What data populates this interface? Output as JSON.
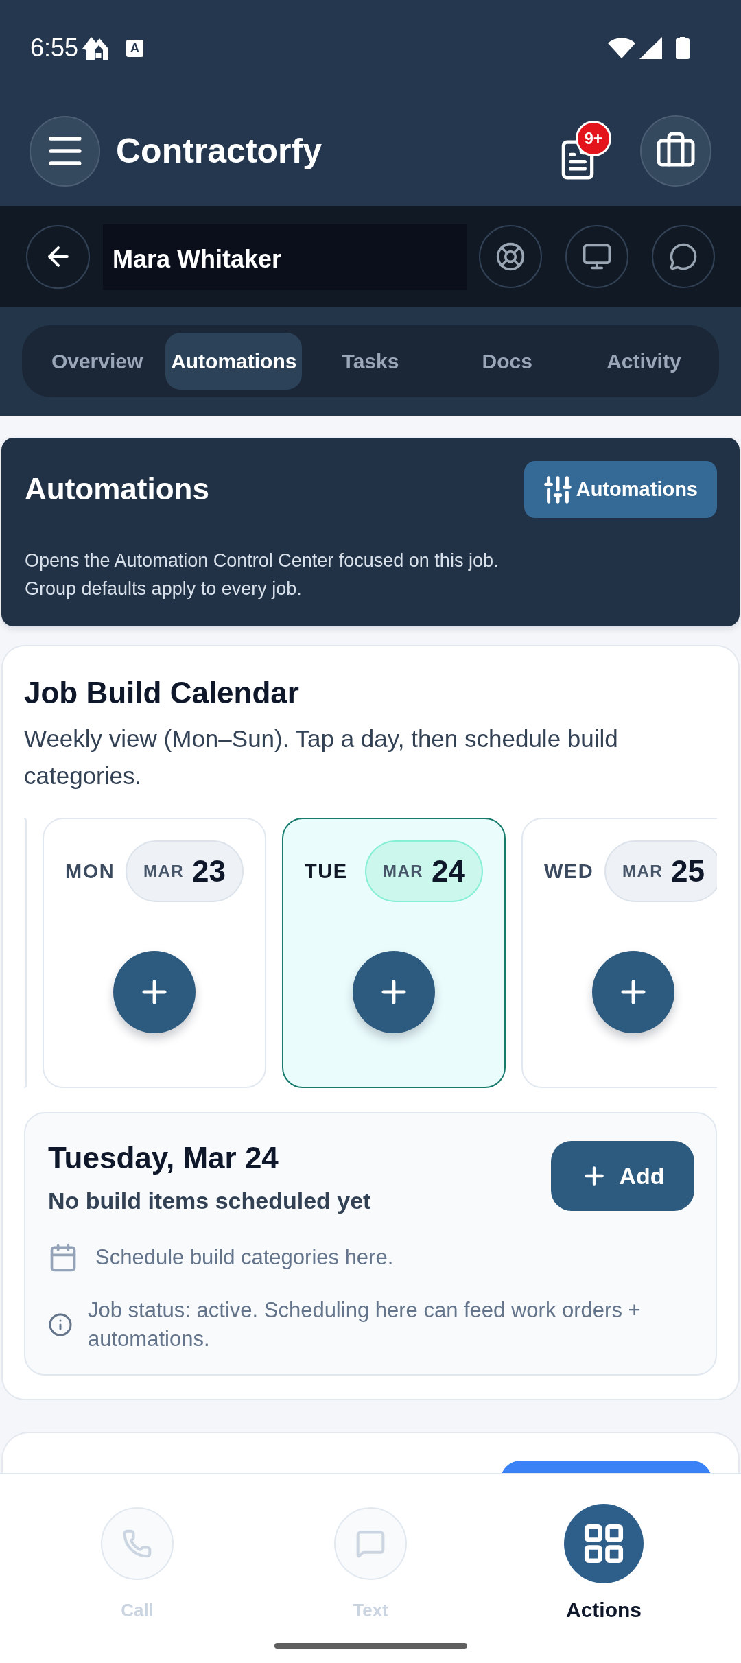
{
  "status_bar": {
    "time": "6:55",
    "notification_letter": "A"
  },
  "header": {
    "title": "Contractorfy",
    "badge": "9+"
  },
  "job_bar": {
    "name": "Mara Whitaker"
  },
  "tabs": [
    {
      "label": "Overview",
      "selected": false
    },
    {
      "label": "Automations",
      "selected": true
    },
    {
      "label": "Tasks",
      "selected": false
    },
    {
      "label": "Docs",
      "selected": false
    },
    {
      "label": "Activity",
      "selected": false
    }
  ],
  "automations_card": {
    "title": "Automations",
    "button": "Automations",
    "lines": [
      "Opens the Automation Control Center focused on this job.",
      "Group defaults apply to every job."
    ]
  },
  "calendar": {
    "title": "Job Build Calendar",
    "description": "Weekly view (Mon–Sun). Tap a day, then schedule build categories.",
    "days": [
      {
        "weekday": "MON",
        "month": "MAR",
        "day": "23",
        "selected": false
      },
      {
        "weekday": "TUE",
        "month": "MAR",
        "day": "24",
        "selected": true
      },
      {
        "weekday": "WED",
        "month": "MAR",
        "day": "25",
        "selected": false
      }
    ],
    "detail": {
      "title": "Tuesday, Mar 24",
      "subtitle": "No build items scheduled yet",
      "button": "Add",
      "notes": [
        {
          "kind": "calendar",
          "text": "Schedule build categories here."
        },
        {
          "kind": "info",
          "text": "Job status: active. Scheduling here can feed work orders + automations."
        }
      ]
    }
  },
  "bottom_nav": [
    {
      "label": "Call",
      "kind": "phone",
      "selected": false
    },
    {
      "label": "Text",
      "kind": "message",
      "selected": false
    },
    {
      "label": "Actions",
      "kind": "grid",
      "selected": true
    }
  ]
}
